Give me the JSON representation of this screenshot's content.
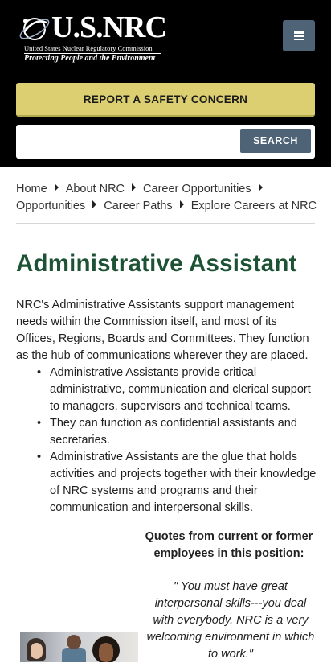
{
  "header": {
    "logo": {
      "title": "U.S.NRC",
      "subtitle": "United States Nuclear Regulatory Commission",
      "tagline": "Protecting People and the Environment"
    },
    "menu_icon": "hamburger-menu-icon",
    "safety_button": "REPORT A SAFETY CONCERN",
    "search": {
      "value": "",
      "placeholder": "",
      "button": "SEARCH"
    }
  },
  "breadcrumb": [
    "Home",
    "About NRC",
    "Career Opportunities",
    "Opportunities",
    "Career Paths",
    "Explore Careers at NRC"
  ],
  "main": {
    "title": "Administrative Assistant",
    "intro": "NRC's Administrative Assistants support management needs within the Commission itself, and most of its Offices, Regions, Boards and Committees. They function as the hub of communications wherever they are placed.",
    "bullets": [
      "Administrative Assistants provide critical administrative, communication and clerical support to managers, supervisors and technical teams.",
      "They can function as confidential assistants and secretaries.",
      "Administrative Assistants are the glue that holds activities and projects together with their knowledge of NRC systems and programs and their communication and interpersonal skills."
    ],
    "quote_heading": "Quotes from current or former employees in this position:",
    "quote": "\" You must have great interpersonal skills---you deal with everybody. NRC is a very welcoming environment in which to work.\""
  },
  "colors": {
    "header_bg": "#000000",
    "accent_button": "#4e6376",
    "safety_button": "#dccf72",
    "title_green": "#1d5235"
  }
}
